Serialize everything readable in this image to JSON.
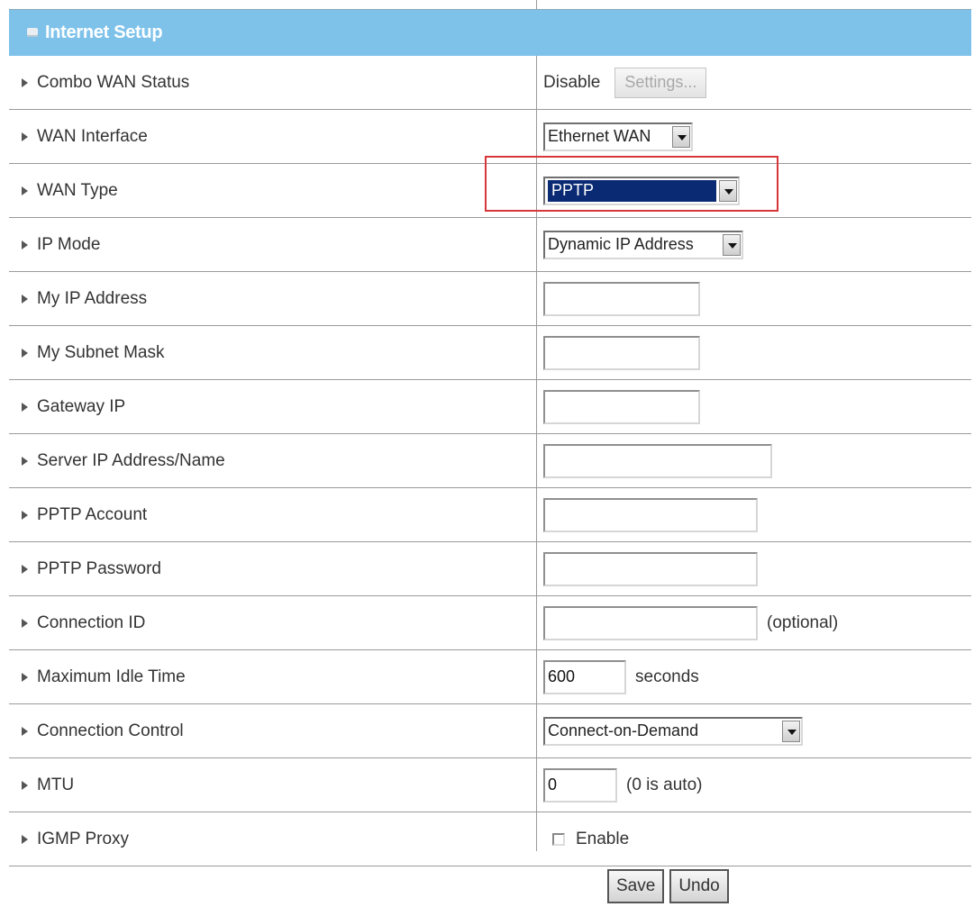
{
  "header": {
    "title": "Internet Setup"
  },
  "rows": {
    "combo_wan_status": {
      "label": "Combo WAN Status",
      "status": "Disable",
      "button": "Settings..."
    },
    "wan_interface": {
      "label": "WAN Interface",
      "value": "Ethernet WAN"
    },
    "wan_type": {
      "label": "WAN Type",
      "value": "PPTP"
    },
    "ip_mode": {
      "label": "IP Mode",
      "value": "Dynamic IP Address"
    },
    "my_ip_address": {
      "label": "My IP Address",
      "value": ""
    },
    "my_subnet_mask": {
      "label": "My Subnet Mask",
      "value": ""
    },
    "gateway_ip": {
      "label": "Gateway IP",
      "value": ""
    },
    "server_ip": {
      "label": "Server IP Address/Name",
      "value": ""
    },
    "pptp_account": {
      "label": "PPTP Account",
      "value": ""
    },
    "pptp_password": {
      "label": "PPTP Password",
      "value": ""
    },
    "connection_id": {
      "label": "Connection ID",
      "value": "",
      "suffix": "(optional)"
    },
    "max_idle_time": {
      "label": "Maximum Idle Time",
      "value": "600",
      "suffix": "seconds"
    },
    "connection_control": {
      "label": "Connection Control",
      "value": "Connect-on-Demand"
    },
    "mtu": {
      "label": "MTU",
      "value": "0",
      "suffix": "(0 is auto)"
    },
    "igmp_proxy": {
      "label": "IGMP Proxy",
      "option": "Enable",
      "checked": false
    }
  },
  "footer": {
    "save": "Save",
    "undo": "Undo"
  },
  "colors": {
    "header_bg": "#7ec2ea",
    "highlight_border": "#d8373a",
    "selected_bg": "#0a2b73"
  }
}
